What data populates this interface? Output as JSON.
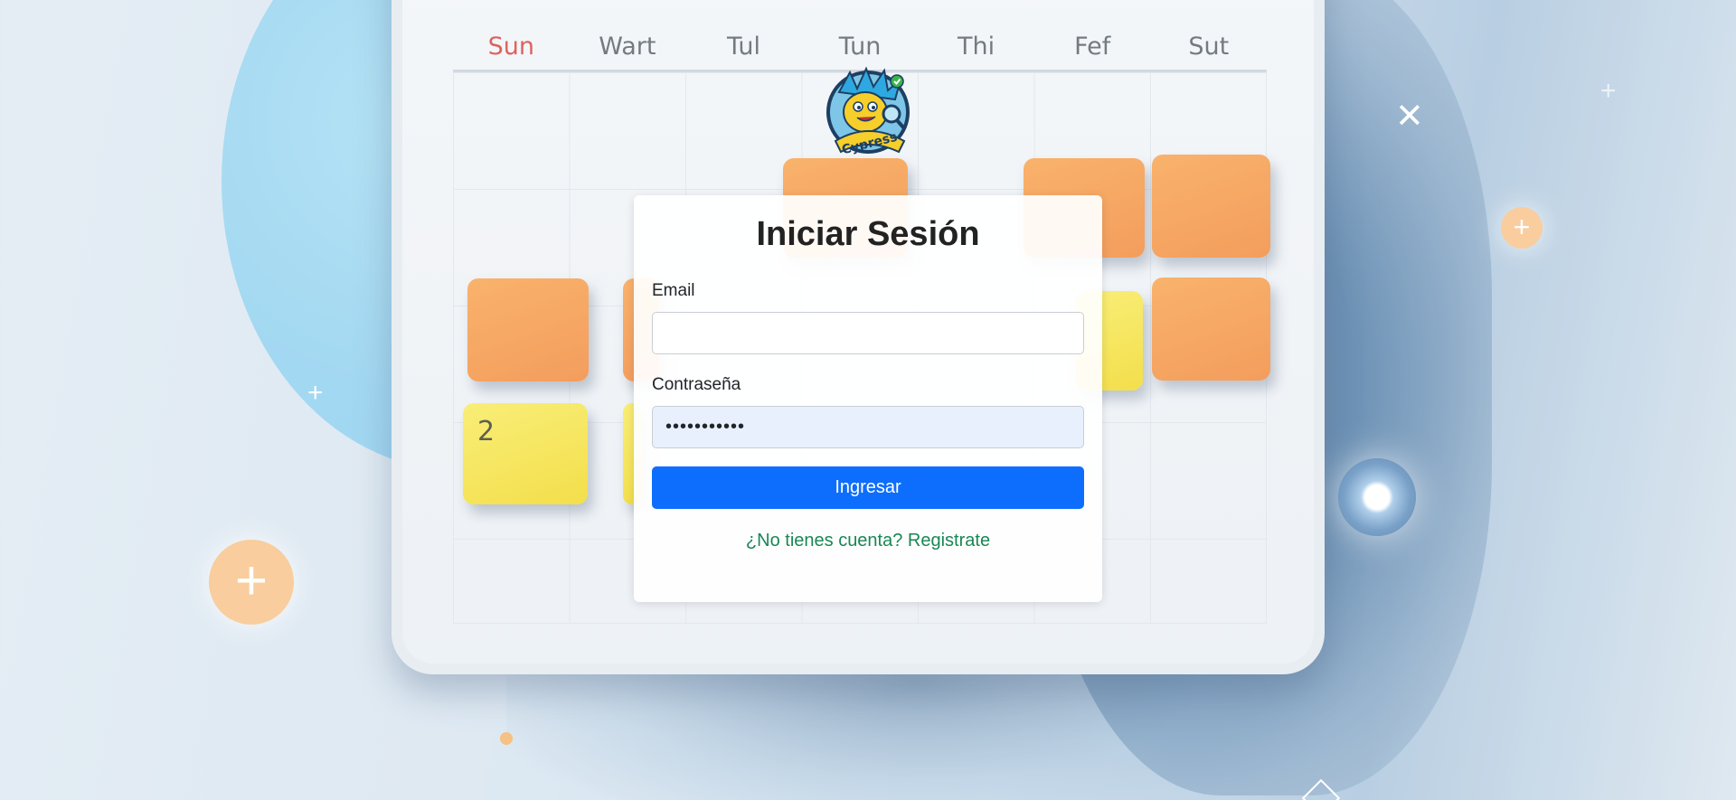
{
  "background": {
    "calendar_days": [
      "Sun",
      "Wart",
      "Tul",
      "Tun",
      "Thi",
      "Fef",
      "Sut"
    ],
    "tile_number": "2",
    "colors": {
      "tile_orange": "#f1883a",
      "tile_yellow": "#f1d824",
      "blob_blue": "#8fd0ef"
    }
  },
  "logo": {
    "icon": "cypress-mascot-icon",
    "text": "Cypress"
  },
  "login": {
    "title": "Iniciar Sesión",
    "email_label": "Email",
    "email_value": "",
    "password_label": "Contraseña",
    "password_value": "•••••••••••",
    "submit_label": "Ingresar",
    "register_link": "¿No tienes cuenta? Registrate"
  },
  "colors": {
    "primary": "#0d6efd",
    "link": "#198754",
    "autofill": "#e8f0fe"
  }
}
